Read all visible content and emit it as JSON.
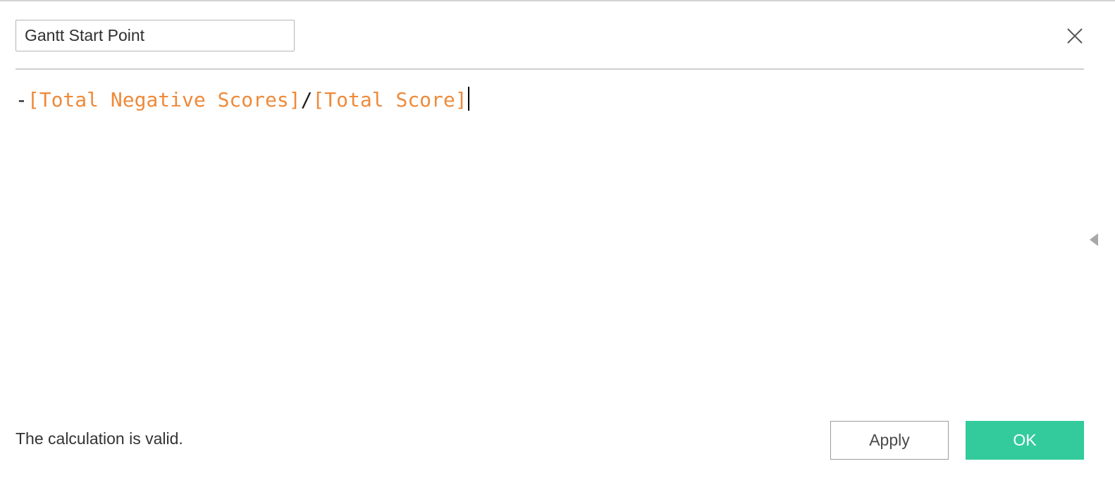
{
  "dialog": {
    "calc_name": "Gantt Start Point",
    "formula": {
      "prefix_operator": "-",
      "field_1": "[Total Negative Scores]",
      "operator": "/",
      "field_2": "[Total Score]"
    },
    "status_message": "The calculation is valid.",
    "apply_label": "Apply",
    "ok_label": "OK"
  },
  "icons": {
    "close": "close-icon",
    "expand": "triangle-left-icon"
  },
  "colors": {
    "field_token": "#ee8a3a",
    "ok_button": "#33cb9c",
    "divider": "#cfcfcf"
  }
}
